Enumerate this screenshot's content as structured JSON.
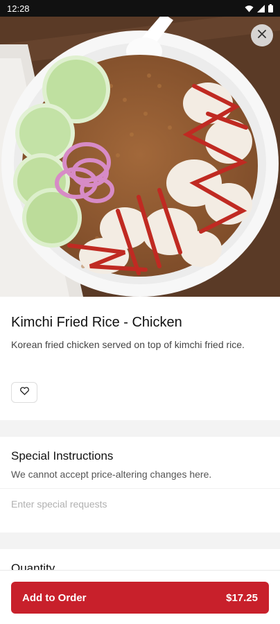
{
  "status_bar": {
    "time": "12:28"
  },
  "item": {
    "title": "Kimchi Fried Rice - Chicken",
    "description": "Korean fried chicken served on top of kimchi fried rice."
  },
  "special_instructions": {
    "heading": "Special Instructions",
    "note": "We cannot accept price-altering changes here.",
    "placeholder": "Enter special requests",
    "value": ""
  },
  "quantity": {
    "heading": "Quantity"
  },
  "order_button": {
    "label": "Add to Order",
    "price": "$17.25"
  },
  "colors": {
    "brand": "#c8202b",
    "status_bar": "#111111",
    "band": "#f3f3f3"
  },
  "icons": [
    "wifi-icon",
    "signal-icon",
    "battery-icon",
    "close-icon",
    "heart-icon"
  ]
}
